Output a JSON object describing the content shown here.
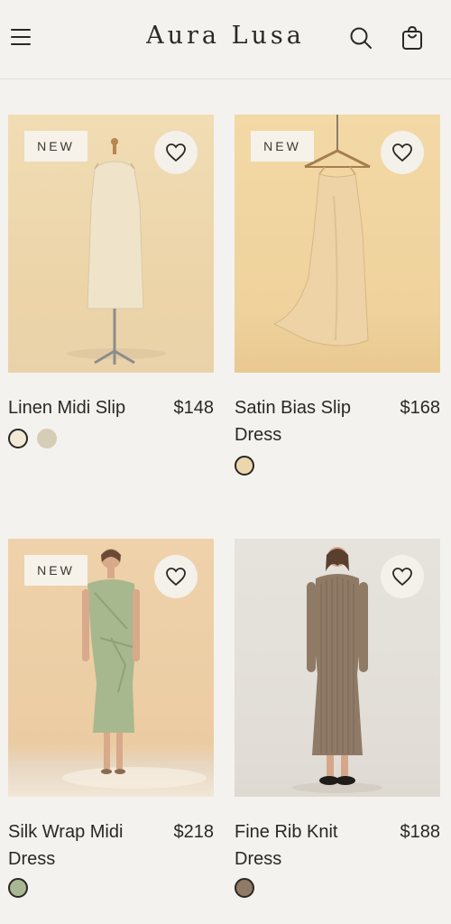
{
  "header": {
    "brand": "Aura Lusa",
    "menu_icon": "hamburger-menu-icon",
    "search_icon": "search-icon",
    "bag_icon": "shopping-bag-icon"
  },
  "products": [
    {
      "badge": "NEW",
      "name": "Linen Midi Slip",
      "price": "$148",
      "swatches": [
        "#f2ead6",
        "#d7cdb6"
      ]
    },
    {
      "badge": "NEW",
      "name": "Satin Bias Slip Dress",
      "price": "$168",
      "swatches": [
        "#ecd7ad"
      ]
    },
    {
      "badge": "NEW",
      "name": "Silk Wrap Midi Dress",
      "price": "$218",
      "swatches": [
        "#a9b892"
      ]
    },
    {
      "badge": "",
      "name": "Fine Rib Knit Dress",
      "price": "$188",
      "swatches": [
        "#8f7a66"
      ]
    }
  ]
}
